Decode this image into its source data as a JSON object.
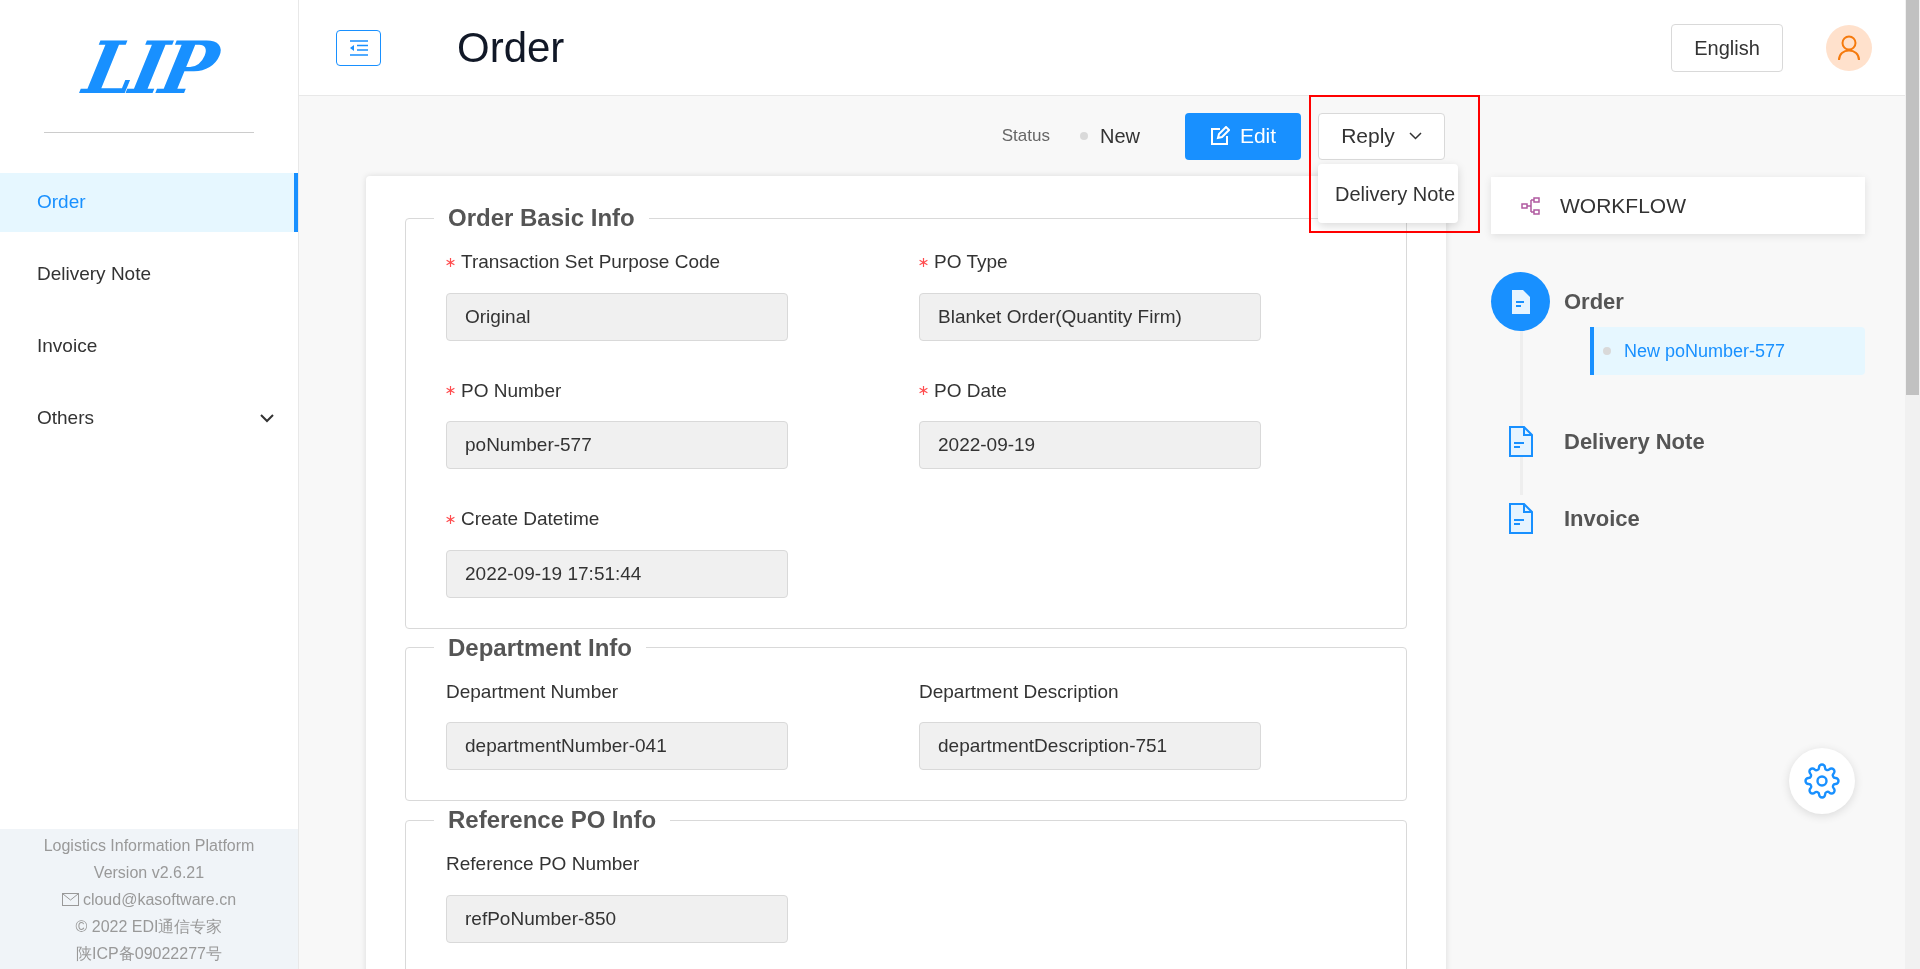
{
  "sidebar": {
    "logo_text": "LIP",
    "items": [
      {
        "label": "Order",
        "selected": true,
        "kind": "link"
      },
      {
        "label": "Delivery Note",
        "selected": false,
        "kind": "link"
      },
      {
        "label": "Invoice",
        "selected": false,
        "kind": "link"
      },
      {
        "label": "Others",
        "selected": false,
        "kind": "submenu",
        "expanded": false
      }
    ],
    "footer": [
      {
        "kind": "text",
        "text": "Logistics Information Platform"
      },
      {
        "kind": "text",
        "text": "Version v2.6.21"
      },
      {
        "kind": "email",
        "text": "cloud@kasoftware.cn"
      },
      {
        "kind": "text",
        "text": "© 2022 EDI通信专家"
      },
      {
        "kind": "text",
        "text": "陕ICP备09022277号"
      }
    ]
  },
  "header": {
    "title": "Order",
    "language": "English"
  },
  "toolbar": {
    "status_label": "Status",
    "status_value": "New",
    "edit_button": "Edit",
    "reply_button": "Reply",
    "reply_menu": [
      "Delivery Note"
    ]
  },
  "sections": [
    {
      "title": "Order Basic Info",
      "fields": [
        {
          "label": "Transaction Set Purpose Code",
          "value": "Original",
          "required": true
        },
        {
          "label": "PO Type",
          "value": "Blanket Order(Quantity Firm)",
          "required": true
        },
        {
          "label": "PO Number",
          "value": "poNumber-577",
          "required": true
        },
        {
          "label": "PO Date",
          "value": "2022-09-19",
          "required": true
        },
        {
          "label": "Create Datetime",
          "value": "2022-09-19 17:51:44",
          "required": true
        }
      ]
    },
    {
      "title": "Department Info",
      "fields": [
        {
          "label": "Department Number",
          "value": "departmentNumber-041",
          "required": false
        },
        {
          "label": "Department Description",
          "value": "departmentDescription-751",
          "required": false
        }
      ]
    },
    {
      "title": "Reference PO Info",
      "fields": [
        {
          "label": "Reference PO Number",
          "value": "refPoNumber-850",
          "required": false
        }
      ]
    }
  ],
  "workflow": {
    "title": "WORKFLOW",
    "steps": [
      {
        "name": "Order",
        "active": true,
        "entries": [
          {
            "status": "New",
            "number": "poNumber-577"
          }
        ]
      },
      {
        "name": "Delivery Note",
        "active": false
      },
      {
        "name": "Invoice",
        "active": false
      }
    ]
  }
}
